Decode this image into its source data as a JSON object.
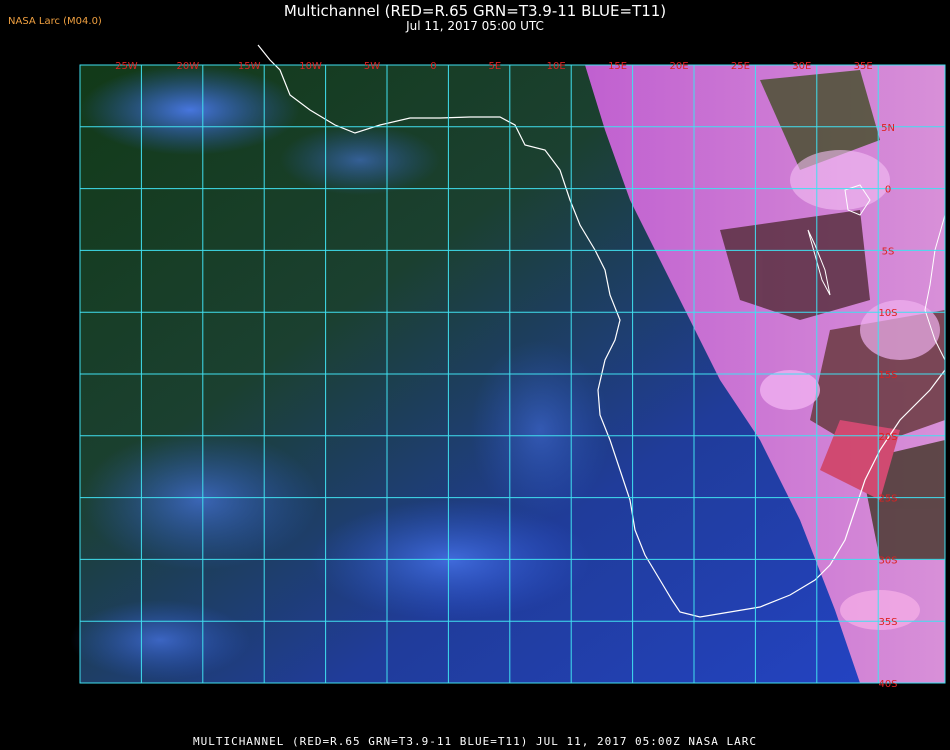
{
  "header": {
    "org_label": "NASA Larc (M04.0)",
    "title": "Multichannel (RED=R.65 GRN=T3.9-11 BLUE=T11)",
    "datetime": "Jul 11, 2017 05:00 UTC"
  },
  "grid": {
    "lon_labels": [
      "25W",
      "20W",
      "15W",
      "10W",
      "5W",
      "0",
      "5E",
      "10E",
      "15E",
      "20E",
      "25E",
      "30E",
      "35E"
    ],
    "lat_labels": [
      "5N",
      "0",
      "5S",
      "10S",
      "15S",
      "20S",
      "25S",
      "30S",
      "35S",
      "40S"
    ]
  },
  "footer": {
    "caption": "MULTICHANNEL (RED=R.65 GRN=T3.9-11 BLUE=T11) JUL 11, 2017 05:00Z   NASA LARC"
  },
  "colors": {
    "grid": "#40e0f0",
    "coast": "#ffffff",
    "label": "#dd2222",
    "ocean_blue": "#2a4fd0",
    "land_green": "#0f3a10",
    "day_pink": "#e080e0"
  }
}
